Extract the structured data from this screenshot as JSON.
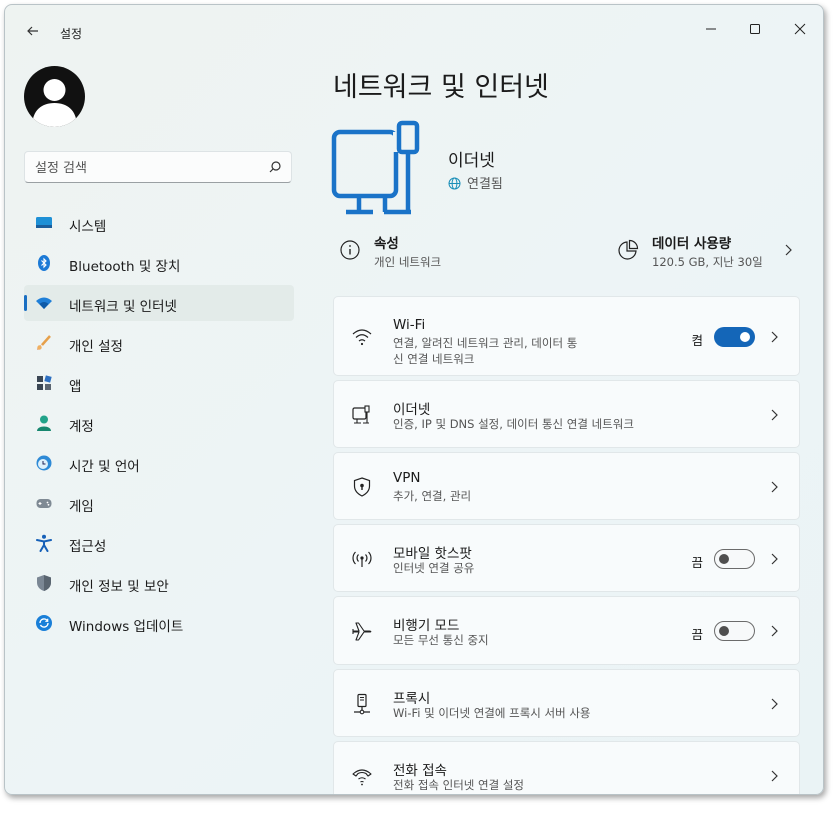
{
  "window": {
    "app_title": "설정"
  },
  "sidebar": {
    "search": {
      "placeholder": "설정 검색"
    },
    "items": [
      {
        "label": "시스템",
        "icon": "monitor-icon"
      },
      {
        "label": "Bluetooth 및 장치",
        "icon": "bluetooth-icon"
      },
      {
        "label": "네트워크 및 인터넷",
        "icon": "wifi-icon",
        "active": true
      },
      {
        "label": "개인 설정",
        "icon": "brush-icon"
      },
      {
        "label": "앱",
        "icon": "apps-icon"
      },
      {
        "label": "계정",
        "icon": "person-icon"
      },
      {
        "label": "시간 및 언어",
        "icon": "globe-clock-icon"
      },
      {
        "label": "게임",
        "icon": "gamepad-icon"
      },
      {
        "label": "접근성",
        "icon": "accessibility-icon"
      },
      {
        "label": "개인 정보 및 보안",
        "icon": "shield-icon"
      },
      {
        "label": "Windows 업데이트",
        "icon": "update-icon"
      }
    ]
  },
  "main": {
    "title": "네트워크 및 인터넷",
    "hero": {
      "name": "이더넷",
      "status": "연결됨"
    },
    "properties": {
      "title": "속성",
      "sub": "개인 네트워크"
    },
    "data_usage": {
      "title": "데이터 사용량",
      "sub": "120.5 GB, 지난 30일"
    },
    "cards": [
      {
        "title": "Wi-Fi",
        "sub": "연결, 알려진 네트워크 관리, 데이터 통신 연결 네트워크",
        "toggle_label": "켬",
        "toggle_on": true,
        "icon": "wifi-icon"
      },
      {
        "title": "이더넷",
        "sub": "인증, IP 및 DNS 설정, 데이터 통신 연결 네트워크",
        "icon": "ethernet-icon"
      },
      {
        "title": "VPN",
        "sub": "추가, 연결, 관리",
        "icon": "vpn-shield-icon"
      },
      {
        "title": "모바일 핫스팟",
        "sub": "인터넷 연결 공유",
        "toggle_label": "끔",
        "toggle_on": false,
        "icon": "hotspot-icon"
      },
      {
        "title": "비행기 모드",
        "sub": "모든 무선 통신 중지",
        "toggle_label": "끔",
        "toggle_on": false,
        "icon": "airplane-icon"
      },
      {
        "title": "프록시",
        "sub": "Wi-Fi 및 이더넷 연결에 프록시 서버 사용",
        "icon": "proxy-icon"
      },
      {
        "title": "전화 접속",
        "sub": "전화 접속 인터넷 연결 설정",
        "icon": "dialup-icon"
      }
    ]
  },
  "colors": {
    "accent": "#1466b8",
    "hero_icon": "#1a73c8",
    "toggle_on": "#1466b8"
  }
}
